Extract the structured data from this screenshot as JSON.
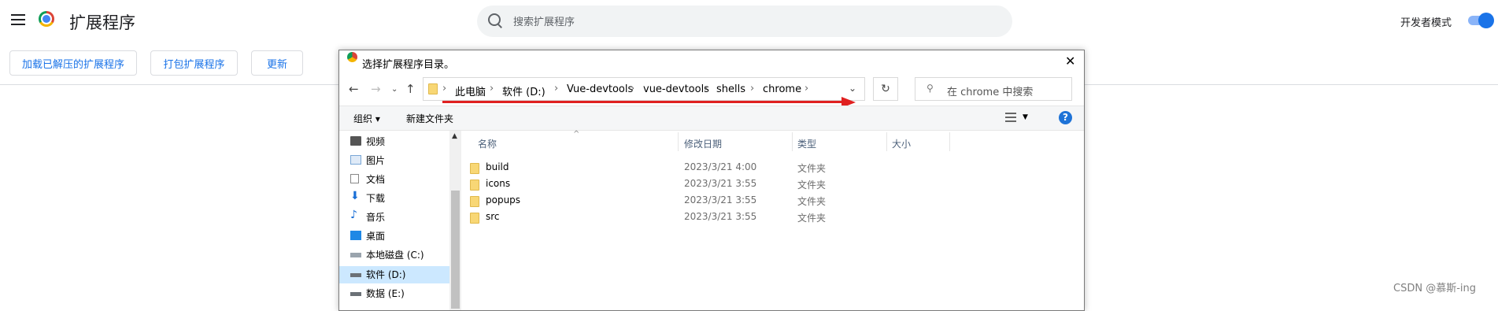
{
  "header": {
    "title": "扩展程序",
    "search_placeholder": "搜索扩展程序",
    "dev_mode_label": "开发者模式",
    "dev_mode_on": true
  },
  "toolbar": {
    "load_unpacked": "加载已解压的扩展程序",
    "pack": "打包扩展程序",
    "update": "更新"
  },
  "dialog": {
    "title": "选择扩展程序目录。",
    "close": "✕",
    "breadcrumb": [
      "此电脑",
      "软件 (D:)",
      "Vue-devtools",
      "vue-devtools",
      "shells",
      "chrome"
    ],
    "search_placeholder": "在 chrome 中搜索",
    "organize": "组织 ▾",
    "new_folder": "新建文件夹",
    "help": "?",
    "nav_items": [
      "视频",
      "图片",
      "文档",
      "下载",
      "音乐",
      "桌面",
      "本地磁盘 (C:)",
      "软件 (D:)",
      "数据 (E:)"
    ],
    "selected_nav": "软件 (D:)",
    "columns": {
      "name": "名称",
      "modified": "修改日期",
      "type": "类型",
      "size": "大小"
    },
    "files": [
      {
        "name": "build",
        "modified": "2023/3/21 4:00",
        "type": "文件夹"
      },
      {
        "name": "icons",
        "modified": "2023/3/21 3:55",
        "type": "文件夹"
      },
      {
        "name": "popups",
        "modified": "2023/3/21 3:55",
        "type": "文件夹"
      },
      {
        "name": "src",
        "modified": "2023/3/21 3:55",
        "type": "文件夹"
      }
    ]
  },
  "watermark": "CSDN @慕斯-ing",
  "colors": {
    "accent": "#1a73e8",
    "annotation_arrow": "#e02020",
    "selected_bg": "#cce8ff"
  }
}
